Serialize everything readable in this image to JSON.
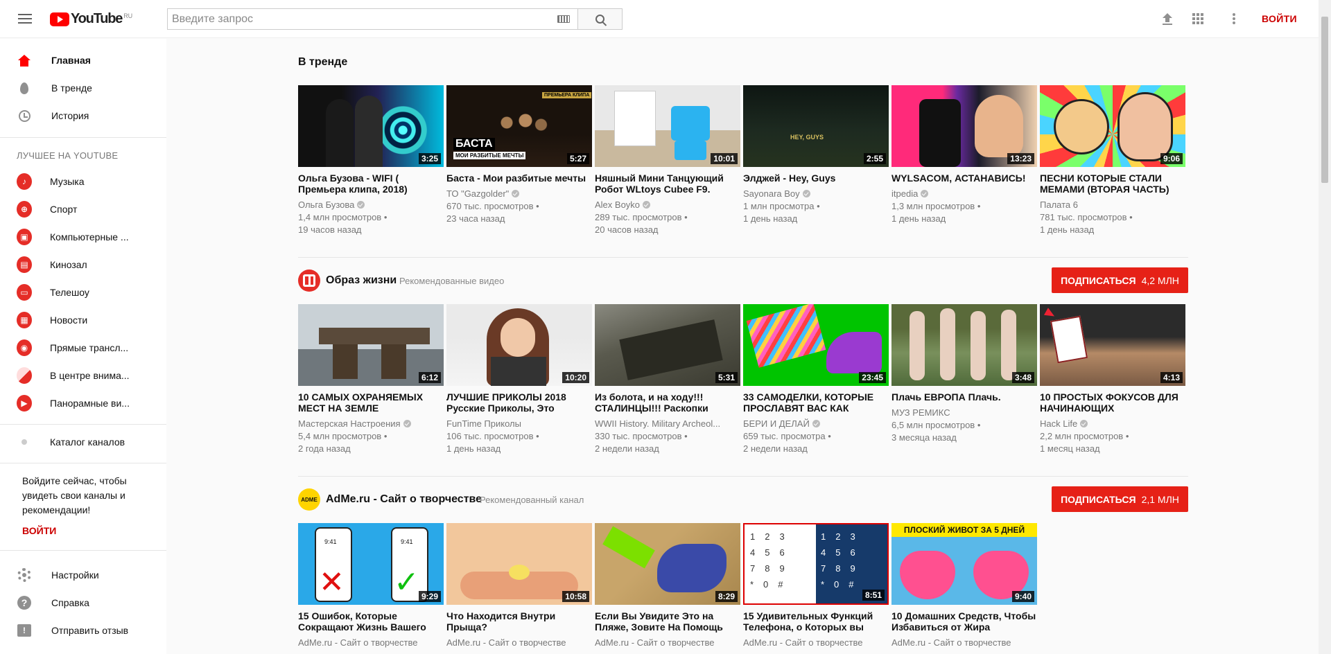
{
  "header": {
    "logo_text": "YouTube",
    "region": "RU",
    "search_placeholder": "Введите запрос",
    "signin": "ВОЙТИ"
  },
  "sidebar": {
    "main": [
      {
        "label": "Главная",
        "icon": "home-icon",
        "active": true
      },
      {
        "label": "В тренде",
        "icon": "trending-icon"
      },
      {
        "label": "История",
        "icon": "history-icon"
      }
    ],
    "best_title": "ЛУЧШЕЕ НА YOUTUBE",
    "best": [
      {
        "label": "Музыка",
        "icon": "music-icon"
      },
      {
        "label": "Спорт",
        "icon": "sport-icon"
      },
      {
        "label": "Компьютерные ...",
        "icon": "gaming-icon"
      },
      {
        "label": "Кинозал",
        "icon": "movies-icon"
      },
      {
        "label": "Телешоу",
        "icon": "tv-icon"
      },
      {
        "label": "Новости",
        "icon": "news-icon"
      },
      {
        "label": "Прямые трансл...",
        "icon": "live-icon"
      },
      {
        "label": "В центре внима...",
        "icon": "spotlight-icon"
      },
      {
        "label": "Панорамные ви...",
        "icon": "360-icon"
      }
    ],
    "catalog": "Каталог каналов",
    "signin_prompt": "Войдите сейчас, чтобы увидеть свои каналы и рекомендации!",
    "signin_link": "ВОЙТИ",
    "footer": [
      {
        "label": "Настройки",
        "icon": "settings-icon"
      },
      {
        "label": "Справка",
        "icon": "help-icon"
      },
      {
        "label": "Отправить отзыв",
        "icon": "feedback-icon"
      }
    ]
  },
  "shelves": [
    {
      "title": "В тренде",
      "videos": [
        {
          "title": "Ольга Бузова - WIFI ( Премьера клипа, 2018)",
          "channel": "Ольга Бузова",
          "verified": true,
          "views": "1,4 млн просмотров",
          "age": "19 часов назад",
          "duration": "3:25"
        },
        {
          "title": "Баста - Мои разбитые мечты",
          "channel": "ТО \"Gazgolder\"",
          "verified": true,
          "views": "670 тыс. просмотров",
          "age": "23 часа назад",
          "duration": "5:27"
        },
        {
          "title": "Няшный Мини Танцующий Робот WLtoys Cubee F9.",
          "channel": "Alex Boyko",
          "verified": true,
          "views": "289 тыс. просмотров",
          "age": "20 часов назад",
          "duration": "10:01"
        },
        {
          "title": "Элджей - Hey, Guys",
          "channel": "Sayonara Boy",
          "verified": true,
          "views": "1 млн просмотра",
          "age": "1 день назад",
          "duration": "2:55"
        },
        {
          "title": "WYLSACOM, АСТАНАВИСЬ!",
          "channel": "itpedia",
          "verified": true,
          "views": "1,3 млн просмотров",
          "age": "1 день назад",
          "duration": "13:23"
        },
        {
          "title": "ПЕСНИ КОТОРЫЕ СТАЛИ МЕМАМИ (ВТОРАЯ ЧАСТЬ)",
          "channel": "Палата 6",
          "verified": false,
          "views": "781 тыс. просмотров",
          "age": "1 день назад",
          "duration": "9:06"
        }
      ]
    },
    {
      "title": "Образ жизни",
      "subtitle": "Рекомендованные видео",
      "subscribe": "ПОДПИСАТЬСЯ",
      "subscribers": "4,2 МЛН",
      "videos": [
        {
          "title": "10 САМЫХ ОХРАНЯЕМЫХ МЕСТ НА ЗЕМЛЕ",
          "channel": "Мастерская Настроения",
          "verified": true,
          "views": "5,4 млн просмотров",
          "age": "2 года назад",
          "duration": "6:12"
        },
        {
          "title": "ЛУЧШИЕ ПРИКОЛЫ 2018 Русские Приколы, Это",
          "channel": "FunTime Приколы",
          "verified": false,
          "views": "106 тыс. просмотров",
          "age": "1 день назад",
          "duration": "10:20"
        },
        {
          "title": "Из болота, и на ходу!!! СТАЛИНЦЫ!!! Раскопки",
          "channel": "WWII History. Military Archeol...",
          "verified": false,
          "views": "330 тыс. просмотров",
          "age": "2 недели назад",
          "duration": "5:31"
        },
        {
          "title": "33 САМОДЕЛКИ, КОТОРЫЕ ПРОСЛАВЯТ ВАС КАК",
          "channel": "БЕРИ И ДЕЛАЙ",
          "verified": true,
          "views": "659 тыс. просмотра",
          "age": "2 недели назад",
          "duration": "23:45"
        },
        {
          "title": "Плачь ЕВРОПА Плачь.",
          "channel": "МУЗ РЕМИКС",
          "verified": false,
          "views": "6,5 млн просмотров",
          "age": "3 месяца назад",
          "duration": "3:48"
        },
        {
          "title": "10 ПРОСТЫХ ФОКУСОВ ДЛЯ НАЧИНАЮЩИХ",
          "channel": "Hack Life",
          "verified": true,
          "views": "2,2 млн просмотров",
          "age": "1 месяц назад",
          "duration": "4:13"
        }
      ]
    },
    {
      "title": "AdMe.ru - Сайт о творчестве",
      "subtitle": "Рекомендованный канал",
      "avatar_text": "ADME",
      "subscribe": "ПОДПИСАТЬСЯ",
      "subscribers": "2,1 МЛН",
      "videos": [
        {
          "title": "15 Ошибок, Которые Сокращают Жизнь Вашего",
          "channel": "AdMe.ru - Сайт о творчестве",
          "duration": "9:29",
          "overlay": "9:41"
        },
        {
          "title": "Что Находится Внутри Прыща?",
          "channel": "AdMe.ru - Сайт о творчестве",
          "duration": "10:58"
        },
        {
          "title": "Если Вы Увидите Это на Пляже, Зовите На Помощь",
          "channel": "AdMe.ru - Сайт о творчестве",
          "duration": "8:29"
        },
        {
          "title": "15 Удивительных Функций Телефона, о Которых вы",
          "channel": "AdMe.ru - Сайт о творчестве",
          "duration": "8:51"
        },
        {
          "title": "10 Домашних Средств, Чтобы Избавиться от Жира",
          "channel": "AdMe.ru - Сайт о творчестве",
          "duration": "9:40",
          "overlay": "ПЛОСКИЙ ЖИВОТ ЗА 5 ДНЕЙ"
        }
      ]
    }
  ],
  "thumb_text": {
    "basta_badge": "ПРЕМЬЕРА КЛИПА",
    "basta_title": "БАСТА",
    "basta_sub": "МОИ РАЗБИТЫЕ МЕЧТЫ",
    "eljay": "HEY, GUYS"
  },
  "colors": {
    "brand_red": "#ff0000",
    "subscribe_red": "#e62117",
    "signin_red": "#cc0000"
  }
}
